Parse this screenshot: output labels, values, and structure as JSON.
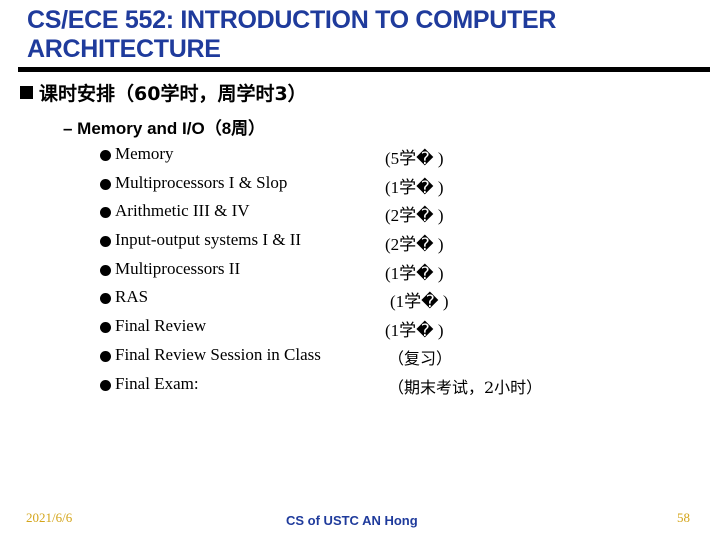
{
  "slide": {
    "title": "CS/ECE 552: INTRODUCTION TO COMPUTER ARCHITECTURE",
    "level1": "课时安排（60学时，周学时3）",
    "level2": "– Memory and I/O（8周）",
    "items": [
      {
        "label": "Memory",
        "hours": "(5学� )"
      },
      {
        "label": "Multiprocessors I & Slop",
        "hours": "(1学� )"
      },
      {
        "label": "Arithmetic III & IV",
        "hours": "(2学� )"
      },
      {
        "label": "Input-output systems I & II",
        "hours": "(2学� )"
      },
      {
        "label": "Multiprocessors II",
        "hours": "(1学� )"
      },
      {
        "label": "RAS",
        "hours": "(1学� )"
      },
      {
        "label": "Final Review",
        "hours": "(1学� )"
      },
      {
        "label": "Final Review Session in Class",
        "hours": "（复习）"
      },
      {
        "label": "Final Exam:",
        "hours": "（期末考试，2小时）"
      }
    ]
  },
  "footer": {
    "date": "2021/6/6",
    "center": "CS of USTC AN Hong",
    "page": "58"
  },
  "colors": {
    "title": "#1f3b9c",
    "footer_date": "#d4a51a",
    "footer_center": "#1f3b9c"
  }
}
